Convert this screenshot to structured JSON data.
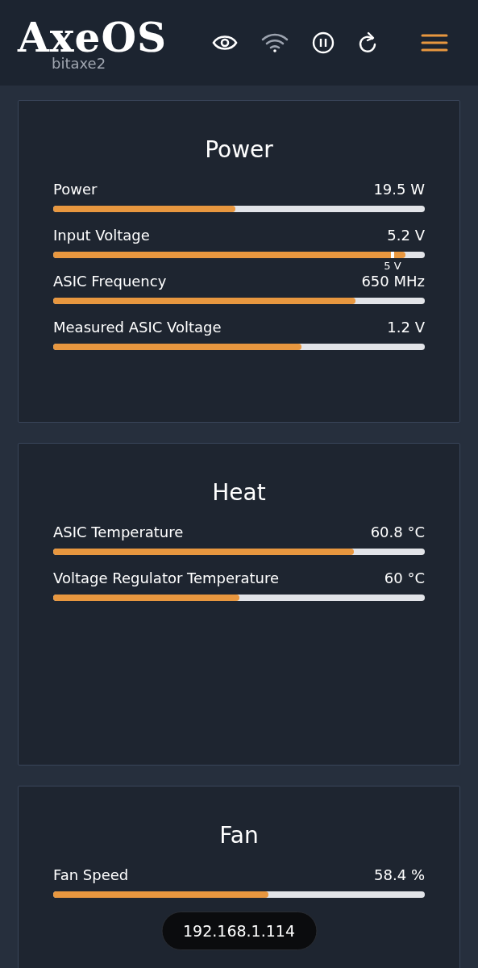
{
  "header": {
    "logo": "AxeOS",
    "device_name": "bitaxe2"
  },
  "cards": [
    {
      "title": "Power",
      "metrics": [
        {
          "label": "Power",
          "value": "19.5 W",
          "level": 0.49
        },
        {
          "label": "Input Voltage",
          "value": "5.2 V",
          "level": 0.948,
          "marker": {
            "level": 0.913,
            "label": "5 V"
          }
        },
        {
          "label": "ASIC Frequency",
          "value": "650 MHz",
          "level": 0.813
        },
        {
          "label": "Measured ASIC Voltage",
          "value": "1.2 V",
          "level": 0.668
        }
      ]
    },
    {
      "title": "Heat",
      "metrics": [
        {
          "label": "ASIC Temperature",
          "value": "60.8 °C",
          "level": 0.809
        },
        {
          "label": "Voltage Regulator Temperature",
          "value": "60 °C",
          "level": 0.501
        }
      ]
    },
    {
      "title": "Fan",
      "metrics": [
        {
          "label": "Fan Speed",
          "value": "58.4 %",
          "level": 0.579
        }
      ]
    }
  ],
  "address_badge": "192.168.1.114"
}
